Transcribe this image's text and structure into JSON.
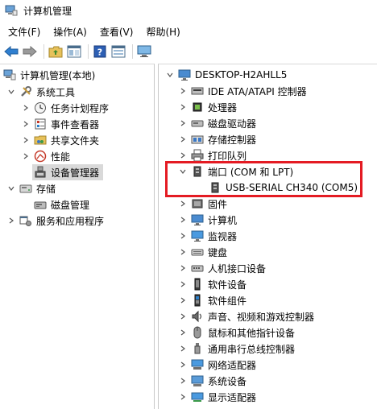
{
  "window": {
    "title": "计算机管理"
  },
  "menu": [
    "文件(F)",
    "操作(A)",
    "查看(V)",
    "帮助(H)"
  ],
  "toolbar": {
    "icons": [
      "back-icon",
      "forward-icon",
      "up-folder-icon",
      "show-tree-icon",
      "help-icon",
      "properties-icon",
      "monitor-icon"
    ]
  },
  "left_tree": {
    "root": "计算机管理(本地)",
    "system_tools": "系统工具",
    "task_scheduler": "任务计划程序",
    "event_viewer": "事件查看器",
    "shared_folders": "共享文件夹",
    "performance": "性能",
    "device_manager": "设备管理器",
    "storage": "存储",
    "disk_management": "磁盘管理",
    "services_apps": "服务和应用程序"
  },
  "right_tree": {
    "computer": "DESKTOP-H2AHLL5",
    "categories": [
      {
        "label": "IDE ATA/ATAPI 控制器",
        "icon": "ide-controller-icon"
      },
      {
        "label": "处理器",
        "icon": "processor-icon"
      },
      {
        "label": "磁盘驱动器",
        "icon": "disk-drive-icon"
      },
      {
        "label": "存储控制器",
        "icon": "storage-controller-icon"
      },
      {
        "label": "打印队列",
        "icon": "printer-icon"
      },
      {
        "label": "端口 (COM 和 LPT)",
        "icon": "port-icon",
        "expanded": true
      },
      {
        "label": "USB-SERIAL CH340 (COM5)",
        "icon": "port-device-icon",
        "child": true
      },
      {
        "label": "固件",
        "icon": "firmware-icon"
      },
      {
        "label": "计算机",
        "icon": "computer-icon"
      },
      {
        "label": "监视器",
        "icon": "monitor-icon"
      },
      {
        "label": "键盘",
        "icon": "keyboard-icon"
      },
      {
        "label": "人机接口设备",
        "icon": "hid-icon"
      },
      {
        "label": "软件设备",
        "icon": "software-device-icon"
      },
      {
        "label": "软件组件",
        "icon": "software-component-icon"
      },
      {
        "label": "声音、视频和游戏控制器",
        "icon": "sound-icon"
      },
      {
        "label": "鼠标和其他指针设备",
        "icon": "mouse-icon"
      },
      {
        "label": "通用串行总线控制器",
        "icon": "usb-icon"
      },
      {
        "label": "网络适配器",
        "icon": "network-adapter-icon"
      },
      {
        "label": "系统设备",
        "icon": "system-device-icon"
      },
      {
        "label": "显示适配器",
        "icon": "display-adapter-icon"
      }
    ]
  },
  "colors": {
    "highlight": "#e41b23",
    "selected": "#d9d9d9"
  }
}
